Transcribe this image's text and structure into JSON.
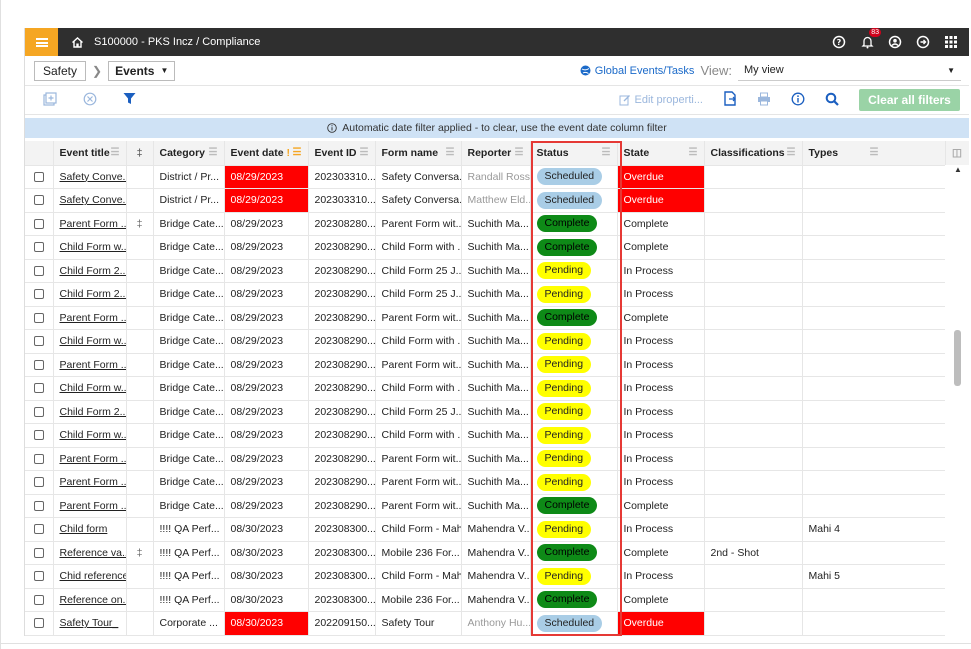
{
  "topbar": {
    "breadcrumb": "S100000 - PKS Incz  /  Compliance",
    "notif_count": "83",
    "menu_icon": "hamburger-icon",
    "home_icon": "home-icon"
  },
  "nav": {
    "module": "Safety",
    "section": "Events",
    "global_link": "Global Events/Tasks",
    "view_label": "View:",
    "view_value": "My view"
  },
  "toolbar": {
    "edit_properties": "Edit properti...",
    "clear_filters": "Clear all filters"
  },
  "notice": {
    "text": "Automatic date filter applied - to clear, use the event date column filter"
  },
  "colors": {
    "accent": "#f5a623",
    "overdue": "#ff0000",
    "scheduled": "#a9cde6",
    "complete": "#0e8a17",
    "pending": "#ffff00",
    "highlight_box": "#e53935"
  },
  "table": {
    "headers": [
      "Event title",
      "",
      "Category",
      "Event date",
      "Event ID",
      "Form name",
      "Reporter",
      "Status",
      "State",
      "Classifications",
      "Types"
    ],
    "rows": [
      {
        "title": "Safety Conve...",
        "attach": "",
        "category": "District / Pr...",
        "date": "08/29/2023",
        "date_red": true,
        "id": "202303310...",
        "form": "Safety Conversa...",
        "reporter": "Randall Ross",
        "reporter_grey": true,
        "status": "Scheduled",
        "state": "Overdue",
        "classifications": "",
        "types": ""
      },
      {
        "title": "Safety Conve...",
        "attach": "",
        "category": "District / Pr...",
        "date": "08/29/2023",
        "date_red": true,
        "id": "202303310...",
        "form": "Safety Conversa...",
        "reporter": "Matthew Eld...",
        "reporter_grey": true,
        "status": "Scheduled",
        "state": "Overdue",
        "classifications": "",
        "types": ""
      },
      {
        "title": "Parent Form ...",
        "attach": "attach",
        "category": "Bridge Cate...",
        "date": "08/29/2023",
        "date_red": false,
        "id": "202308280...",
        "form": "Parent Form wit...",
        "reporter": "Suchith Ma...",
        "reporter_grey": false,
        "status": "Complete",
        "state": "Complete",
        "classifications": "",
        "types": ""
      },
      {
        "title": "Child Form w...",
        "attach": "",
        "category": "Bridge Cate...",
        "date": "08/29/2023",
        "date_red": false,
        "id": "202308290...",
        "form": "Child Form with ...",
        "reporter": "Suchith Ma...",
        "reporter_grey": false,
        "status": "Complete",
        "state": "Complete",
        "classifications": "",
        "types": ""
      },
      {
        "title": "Child Form 2...",
        "attach": "",
        "category": "Bridge Cate...",
        "date": "08/29/2023",
        "date_red": false,
        "id": "202308290...",
        "form": "Child Form 25 J...",
        "reporter": "Suchith Ma...",
        "reporter_grey": false,
        "status": "Pending",
        "state": "In Process",
        "classifications": "",
        "types": ""
      },
      {
        "title": "Child Form 2...",
        "attach": "",
        "category": "Bridge Cate...",
        "date": "08/29/2023",
        "date_red": false,
        "id": "202308290...",
        "form": "Child Form 25 J...",
        "reporter": "Suchith Ma...",
        "reporter_grey": false,
        "status": "Pending",
        "state": "In Process",
        "classifications": "",
        "types": ""
      },
      {
        "title": "Parent Form ...",
        "attach": "",
        "category": "Bridge Cate...",
        "date": "08/29/2023",
        "date_red": false,
        "id": "202308290...",
        "form": "Parent Form wit...",
        "reporter": "Suchith Ma...",
        "reporter_grey": false,
        "status": "Complete",
        "state": "Complete",
        "classifications": "",
        "types": ""
      },
      {
        "title": "Child Form w...",
        "attach": "",
        "category": "Bridge Cate...",
        "date": "08/29/2023",
        "date_red": false,
        "id": "202308290...",
        "form": "Child Form with ...",
        "reporter": "Suchith Ma...",
        "reporter_grey": false,
        "status": "Pending",
        "state": "In Process",
        "classifications": "",
        "types": ""
      },
      {
        "title": "Parent Form ...",
        "attach": "",
        "category": "Bridge Cate...",
        "date": "08/29/2023",
        "date_red": false,
        "id": "202308290...",
        "form": "Parent Form wit...",
        "reporter": "Suchith Ma...",
        "reporter_grey": false,
        "status": "Pending",
        "state": "In Process",
        "classifications": "",
        "types": ""
      },
      {
        "title": "Child Form w...",
        "attach": "",
        "category": "Bridge Cate...",
        "date": "08/29/2023",
        "date_red": false,
        "id": "202308290...",
        "form": "Child Form with ...",
        "reporter": "Suchith Ma...",
        "reporter_grey": false,
        "status": "Pending",
        "state": "In Process",
        "classifications": "",
        "types": ""
      },
      {
        "title": "Child Form 2...",
        "attach": "",
        "category": "Bridge Cate...",
        "date": "08/29/2023",
        "date_red": false,
        "id": "202308290...",
        "form": "Child Form 25 J...",
        "reporter": "Suchith Ma...",
        "reporter_grey": false,
        "status": "Pending",
        "state": "In Process",
        "classifications": "",
        "types": ""
      },
      {
        "title": "Child Form w...",
        "attach": "",
        "category": "Bridge Cate...",
        "date": "08/29/2023",
        "date_red": false,
        "id": "202308290...",
        "form": "Child Form with ...",
        "reporter": "Suchith Ma...",
        "reporter_grey": false,
        "status": "Pending",
        "state": "In Process",
        "classifications": "",
        "types": ""
      },
      {
        "title": "Parent Form ...",
        "attach": "",
        "category": "Bridge Cate...",
        "date": "08/29/2023",
        "date_red": false,
        "id": "202308290...",
        "form": "Parent Form wit...",
        "reporter": "Suchith Ma...",
        "reporter_grey": false,
        "status": "Pending",
        "state": "In Process",
        "classifications": "",
        "types": ""
      },
      {
        "title": "Parent Form ...",
        "attach": "",
        "category": "Bridge Cate...",
        "date": "08/29/2023",
        "date_red": false,
        "id": "202308290...",
        "form": "Parent Form wit...",
        "reporter": "Suchith Ma...",
        "reporter_grey": false,
        "status": "Pending",
        "state": "In Process",
        "classifications": "",
        "types": ""
      },
      {
        "title": "Parent Form ...",
        "attach": "",
        "category": "Bridge Cate...",
        "date": "08/29/2023",
        "date_red": false,
        "id": "202308290...",
        "form": "Parent Form wit...",
        "reporter": "Suchith Ma...",
        "reporter_grey": false,
        "status": "Complete",
        "state": "Complete",
        "classifications": "",
        "types": ""
      },
      {
        "title": "Child form",
        "attach": "",
        "category": "!!!! QA Perf...",
        "date": "08/30/2023",
        "date_red": false,
        "id": "202308300...",
        "form": "Child Form - Mahi",
        "reporter": "Mahendra V...",
        "reporter_grey": false,
        "status": "Pending",
        "state": "In Process",
        "classifications": "",
        "types": "Mahi 4"
      },
      {
        "title": "Reference va...",
        "attach": "attach",
        "category": "!!!! QA Perf...",
        "date": "08/30/2023",
        "date_red": false,
        "id": "202308300...",
        "form": "Mobile 236 For...",
        "reporter": "Mahendra V...",
        "reporter_grey": false,
        "status": "Complete",
        "state": "Complete",
        "classifications": "2nd - Shot",
        "types": ""
      },
      {
        "title": "Chid reference",
        "attach": "",
        "category": "!!!! QA Perf...",
        "date": "08/30/2023",
        "date_red": false,
        "id": "202308300...",
        "form": "Child Form - Mahi",
        "reporter": "Mahendra V...",
        "reporter_grey": false,
        "status": "Pending",
        "state": "In Process",
        "classifications": "",
        "types": "Mahi 5"
      },
      {
        "title": "Reference on...",
        "attach": "",
        "category": "!!!! QA Perf...",
        "date": "08/30/2023",
        "date_red": false,
        "id": "202308300...",
        "form": "Mobile 236 For...",
        "reporter": "Mahendra V...",
        "reporter_grey": false,
        "status": "Complete",
        "state": "Complete",
        "classifications": "",
        "types": ""
      },
      {
        "title": "Safety Tour_",
        "attach": "",
        "category": "Corporate ...",
        "date": "08/30/2023",
        "date_red": true,
        "id": "202209150...",
        "form": "Safety Tour",
        "reporter": "Anthony Hu...",
        "reporter_grey": true,
        "status": "Scheduled",
        "state": "Overdue",
        "classifications": "",
        "types": ""
      }
    ]
  }
}
